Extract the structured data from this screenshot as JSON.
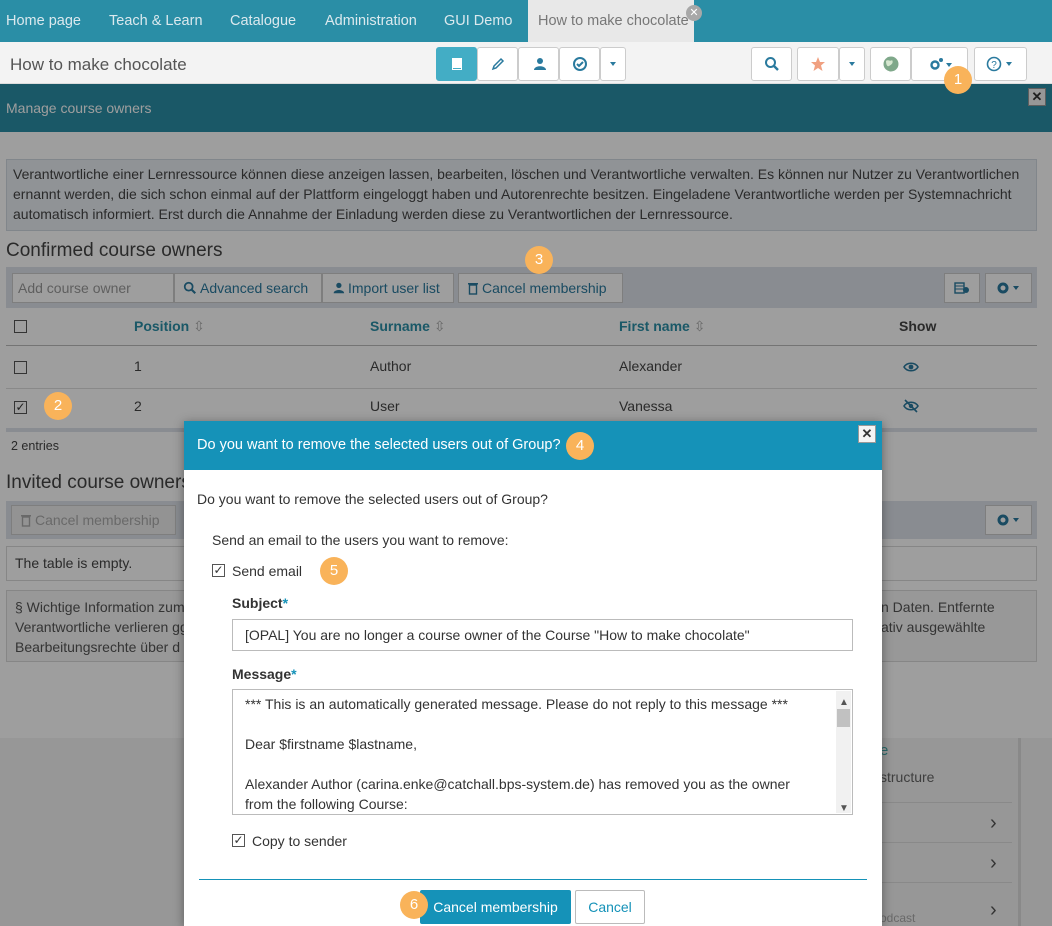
{
  "nav": {
    "tabs": [
      "Home page",
      "Teach & Learn",
      "Catalogue",
      "Administration",
      "GUI Demo",
      "How to make chocolate"
    ],
    "close_symbol": "✕"
  },
  "toolbar": {
    "title": "How to make chocolate",
    "icons": [
      "book-icon",
      "pencil-icon",
      "users-icon",
      "check-circle-icon",
      "chevron-down-icon",
      "search-icon",
      "star-icon",
      "chevron-down-icon",
      "globe-icon",
      "gears-icon",
      "help-icon"
    ]
  },
  "manage": {
    "title": "Manage course owners",
    "info": "Verantwortliche einer Lernressource können diese anzeigen lassen, bearbeiten, löschen und Verantwortliche verwalten. Es können nur Nutzer zu Verantwortlichen ernannt werden, die sich schon einmal auf der Plattform eingeloggt haben und Autorenrechte besitzen. Eingeladene Verantwortliche werden per Systemnachricht automatisch informiert. Erst durch die Annahme der Einladung werden diese zu Verantwortlichen der Lernressource.",
    "confirmed_heading": "Confirmed course owners",
    "add_placeholder": "Add course owner",
    "advanced_search": "Advanced search",
    "import_list": "Import user list",
    "cancel_membership": "Cancel membership",
    "columns": {
      "position": "Position",
      "surname": "Surname",
      "firstname": "First name",
      "show": "Show"
    },
    "rows": [
      {
        "position": "1",
        "surname": "Author",
        "firstname": "Alexander",
        "checked": false
      },
      {
        "position": "2",
        "surname": "User",
        "firstname": "Vanessa",
        "checked": true
      }
    ],
    "entries": "2 entries",
    "invited_heading": "Invited course owners",
    "invited_cancel": "Cancel membership",
    "empty": "The table is empty.",
    "legal_left_1": "§ Wichtige Information zum",
    "legal_left_2": "Verantwortliche verlieren gg",
    "legal_left_3": "Bearbeitungsrechte über d",
    "legal_right_1": "n Daten. Entfernte",
    "legal_right_2": "ativ ausgewählte"
  },
  "background_side": {
    "item1": "e",
    "item2": "structure",
    "item3": "odcast"
  },
  "dialog": {
    "title": "Do you want to remove the selected users out of Group?",
    "question": "Do you want to remove the selected users out of Group?",
    "email_prompt": "Send an email to the users you want to remove:",
    "send_email": "Send email",
    "subject_label": "Subject",
    "subject_value": "[OPAL] You are no longer a course owner of the Course \"How to make chocolate\"",
    "message_label": "Message",
    "message_line1": "*** This is an automatically generated message. Please do not reply to this message ***",
    "message_line2": "Dear $firstname $lastname,",
    "message_line3": "Alexander Author (carina.enke@catchall.bps-system.de) has removed you as the owner",
    "message_line4": "from the following Course:",
    "copy_sender": "Copy to sender",
    "confirm": "Cancel membership",
    "cancel": "Cancel",
    "required_mark": "*"
  },
  "badges": [
    "1",
    "2",
    "3",
    "4",
    "5",
    "6"
  ],
  "colors": {
    "teal": "#2a8ea6",
    "dialog_teal": "#1592b8",
    "badge": "#f9b35a"
  }
}
